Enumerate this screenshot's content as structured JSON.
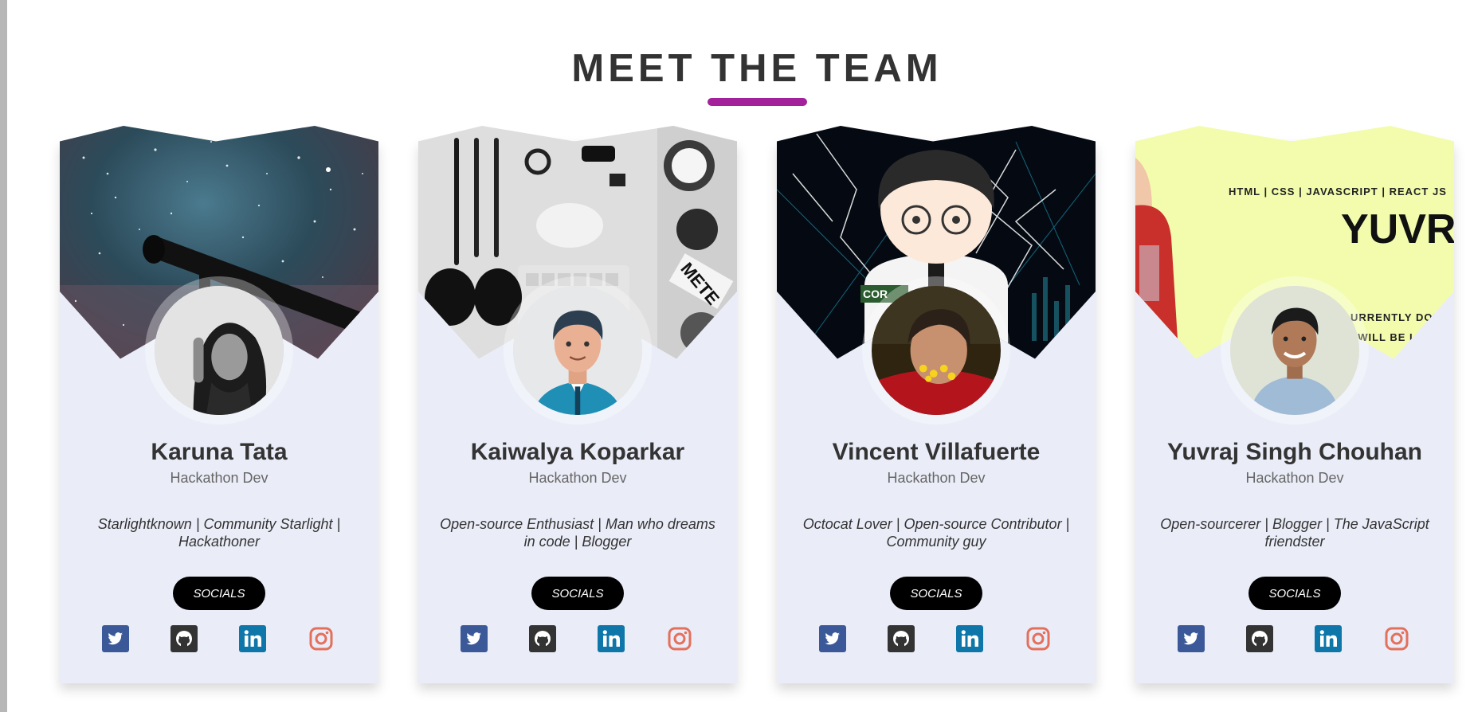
{
  "section": {
    "title": "MEET THE TEAM",
    "accent_color": "#a3229b"
  },
  "team": [
    {
      "name": "Karuna Tata",
      "role": "Hackathon Dev",
      "bio": "Starlightknown | Community Starlight | Hackathoner",
      "socials_label": "SOCIALS",
      "cover": "starry-sky-telescope",
      "avatar": "woman-portrait-bw"
    },
    {
      "name": "Kaiwalya Koparkar",
      "role": "Hackathon Dev",
      "bio": "Open-source Enthusiast | Man who dreams in code | Blogger",
      "socials_label": "SOCIALS",
      "cover": "desk-flatlay-stickers",
      "avatar": "cartoon-man-avatar"
    },
    {
      "name": "Vincent Villafuerte",
      "role": "Hackathon Dev",
      "bio": "Octocat Lover | Open-source Contributor | Community guy",
      "socials_label": "SOCIALS",
      "cover": "anime-character-neon",
      "avatar": "man-red-photo"
    },
    {
      "name": "Yuvraj Singh Chouhan",
      "role": "Hackathon Dev",
      "bio": "Open-sourcerer | Blogger | The JavaScript friendster",
      "socials_label": "SOCIALS",
      "cover": "yellow-banner",
      "avatar": "man-portrait-photo",
      "cover_banner": {
        "skills": "HTML | CSS | JAVASCRIPT | REACT JS",
        "name": "YUVR",
        "line1": "URRENTLY DOING",
        "line2": "I WILL BE LEA"
      }
    }
  ],
  "social_icons": [
    {
      "name": "twitter",
      "color": "#3b5998"
    },
    {
      "name": "github",
      "color": "#333333"
    },
    {
      "name": "linkedin",
      "color": "#0e76a8"
    },
    {
      "name": "instagram",
      "color": "#e4705b"
    }
  ]
}
